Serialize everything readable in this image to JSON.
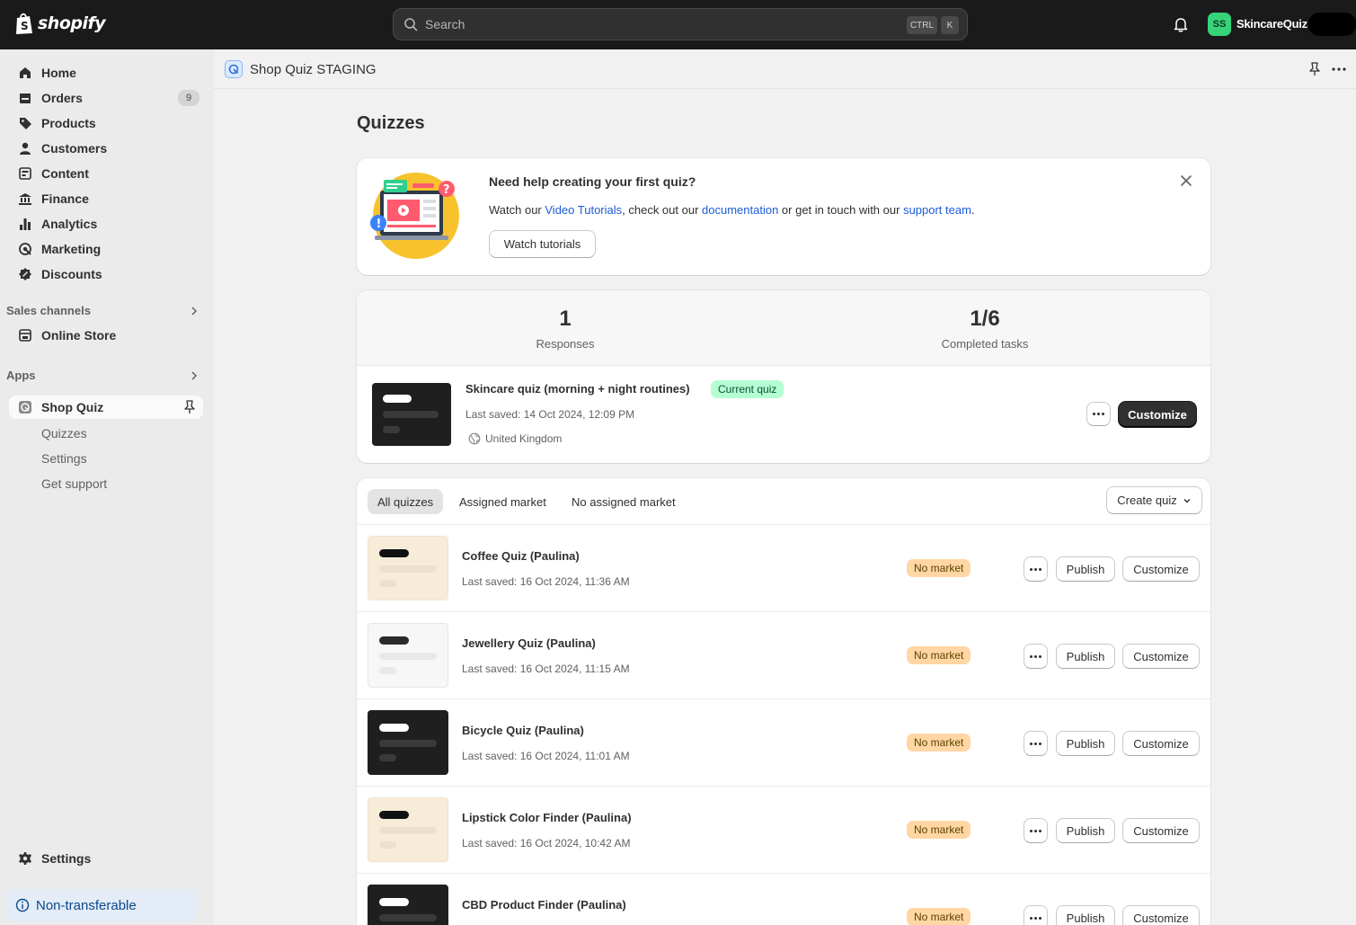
{
  "topbar": {
    "logo_text": "shopify",
    "search_placeholder": "Search",
    "kbd_ctrl": "CTRL",
    "kbd_k": "K",
    "avatar_initials": "SS",
    "store_name": "SkincareQuiz"
  },
  "sidebar": {
    "items": [
      {
        "label": "Home",
        "icon": "home-icon"
      },
      {
        "label": "Orders",
        "icon": "orders-icon",
        "badge": "9"
      },
      {
        "label": "Products",
        "icon": "tag-icon"
      },
      {
        "label": "Customers",
        "icon": "person-icon"
      },
      {
        "label": "Content",
        "icon": "content-icon"
      },
      {
        "label": "Finance",
        "icon": "bank-icon"
      },
      {
        "label": "Analytics",
        "icon": "bar-chart-icon"
      },
      {
        "label": "Marketing",
        "icon": "target-icon"
      },
      {
        "label": "Discounts",
        "icon": "discount-icon"
      }
    ],
    "sales_channels_label": "Sales channels",
    "online_store_label": "Online Store",
    "apps_label": "Apps",
    "app_name": "Shop Quiz",
    "app_subitems": [
      "Quizzes",
      "Settings",
      "Get support"
    ],
    "settings_label": "Settings",
    "non_transferable_label": "Non-transferable"
  },
  "appbar": {
    "title": "Shop Quiz STAGING"
  },
  "page": {
    "title": "Quizzes"
  },
  "help_card": {
    "title": "Need help creating your first quiz?",
    "text_1": "Watch our ",
    "link_1": "Video Tutorials",
    "text_2": ", check out our ",
    "link_2": "documentation",
    "text_3": " or get in touch with our ",
    "link_3": "support team",
    "text_4": ".",
    "button_label": "Watch tutorials"
  },
  "stats": {
    "responses_value": "1",
    "responses_label": "Responses",
    "tasks_value": "1/6",
    "tasks_label": "Completed tasks"
  },
  "current_quiz": {
    "name": "Skincare quiz (morning + night routines)",
    "badge": "Current quiz",
    "saved": "Last saved: 14 Oct 2024, 12:09 PM",
    "market": "United Kingdom",
    "customize_label": "Customize"
  },
  "quiz_list": {
    "tabs": [
      "All quizzes",
      "Assigned market",
      "No assigned market"
    ],
    "create_label": "Create quiz",
    "publish_label": "Publish",
    "customize_label": "Customize",
    "rows": [
      {
        "name": "Coffee Quiz (Paulina)",
        "saved": "Last saved: 16 Oct 2024, 11:36 AM",
        "market": "No market",
        "theme": "cream"
      },
      {
        "name": "Jewellery Quiz (Paulina)",
        "saved": "Last saved: 16 Oct 2024, 11:15 AM",
        "market": "No market",
        "theme": "light"
      },
      {
        "name": "Bicycle Quiz (Paulina)",
        "saved": "Last saved: 16 Oct 2024, 11:01 AM",
        "market": "No market",
        "theme": "dark"
      },
      {
        "name": "Lipstick Color Finder (Paulina)",
        "saved": "Last saved: 16 Oct 2024, 10:42 AM",
        "market": "No market",
        "theme": "cream"
      },
      {
        "name": "CBD Product Finder (Paulina)",
        "saved": "",
        "market": "No market",
        "theme": "dark"
      }
    ]
  },
  "colors": {
    "topbar_bg": "#1a1a1a",
    "link": "#1d5bd6",
    "current_badge_bg": "#b4fed2",
    "no_market_badge_bg": "#ffd6a4",
    "avatar_bg": "#36d37a"
  }
}
